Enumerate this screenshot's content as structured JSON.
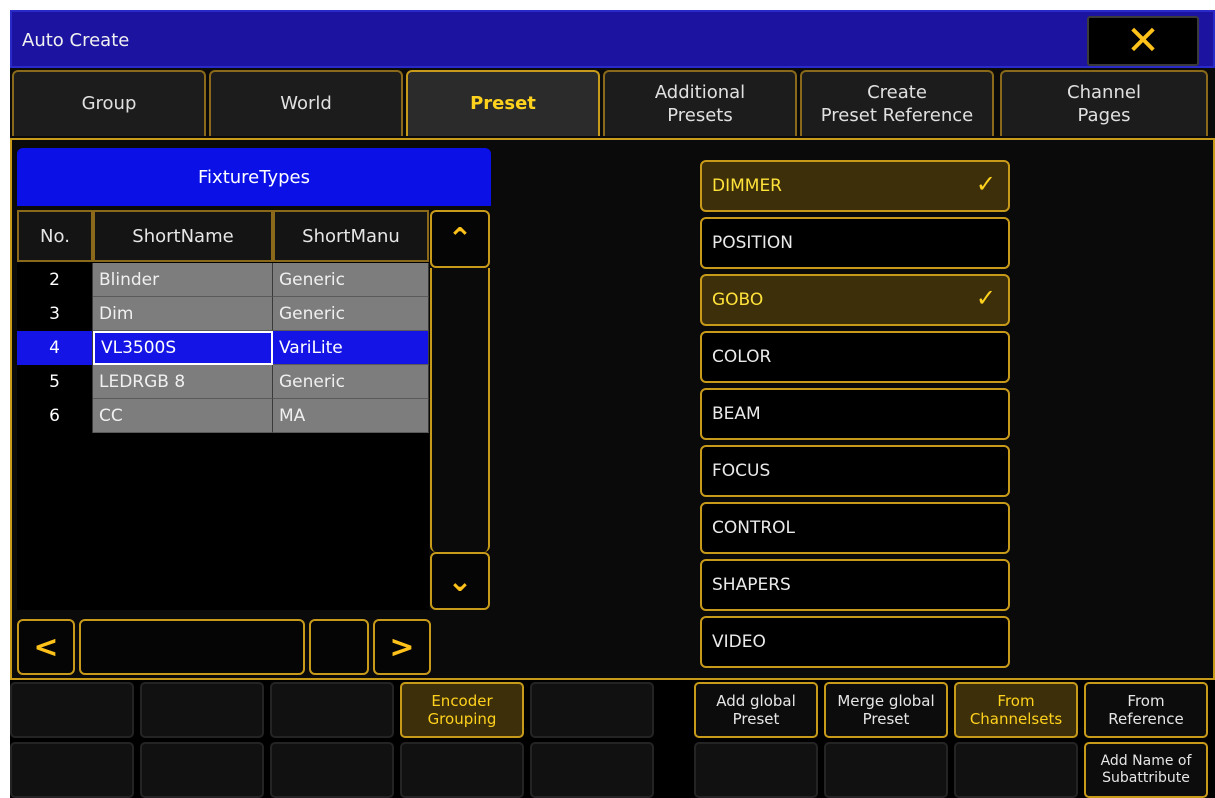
{
  "window": {
    "title": "Auto Create",
    "close_icon": "✕"
  },
  "tabs": [
    {
      "label": "Group",
      "active": false
    },
    {
      "label": "World",
      "active": false
    },
    {
      "label": "Preset",
      "active": true
    },
    {
      "label": "Additional\nPresets",
      "active": false
    },
    {
      "label": "Create\nPreset Reference",
      "active": false
    },
    {
      "label": "Channel\nPages",
      "active": false
    }
  ],
  "fixture_types": {
    "header": "FixtureTypes",
    "columns": [
      "No.",
      "ShortName",
      "ShortManu"
    ],
    "rows": [
      {
        "no": "2",
        "short_name": "Blinder",
        "short_manu": "Generic",
        "selected": false
      },
      {
        "no": "3",
        "short_name": "Dim",
        "short_manu": "Generic",
        "selected": false
      },
      {
        "no": "4",
        "short_name": "VL3500S",
        "short_manu": "VariLite",
        "selected": true
      },
      {
        "no": "5",
        "short_name": "LEDRGB 8",
        "short_manu": "Generic",
        "selected": false
      },
      {
        "no": "6",
        "short_name": "CC",
        "short_manu": "MA",
        "selected": false
      }
    ],
    "scroll_up_icon": "⌃",
    "scroll_down_icon": "⌄",
    "scroll_left_icon": "<",
    "scroll_right_icon": ">"
  },
  "attributes": [
    {
      "label": "DIMMER",
      "checked": true
    },
    {
      "label": "POSITION",
      "checked": false
    },
    {
      "label": "GOBO",
      "checked": true
    },
    {
      "label": "COLOR",
      "checked": false
    },
    {
      "label": "BEAM",
      "checked": false
    },
    {
      "label": "FOCUS",
      "checked": false
    },
    {
      "label": "CONTROL",
      "checked": false
    },
    {
      "label": "SHAPERS",
      "checked": false
    },
    {
      "label": "VIDEO",
      "checked": false
    }
  ],
  "check_icon": "✓",
  "bottom": {
    "encoder_grouping": "Encoder\nGrouping",
    "add_global_preset": "Add global\nPreset",
    "merge_global_preset": "Merge global\nPreset",
    "from_channelsets": "From\nChannelsets",
    "from_reference": "From\nReference",
    "add_name_subattribute": "Add Name of\nSubattribute"
  },
  "colors": {
    "accent": "#c89a1a",
    "title_bar": "#1c14a0",
    "selection": "#1414e6",
    "check": "#ffd21e"
  }
}
